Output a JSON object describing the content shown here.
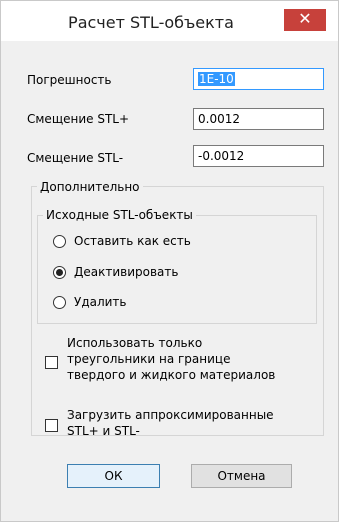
{
  "window": {
    "title": "Расчет STL-объекта",
    "close_symbol": "✕"
  },
  "fields": {
    "tolerance_label": "Погрешность",
    "tolerance_value": "1E-10",
    "offset_plus_label": "Смещение STL+",
    "offset_plus_value": "0.0012",
    "offset_minus_label": "Смещение STL-",
    "offset_minus_value": "-0.0012"
  },
  "additional": {
    "title": "Дополнительно",
    "source_group": {
      "title": "Исходные STL-объекты",
      "options": [
        {
          "label": "Оставить как есть",
          "selected": false
        },
        {
          "label": "Деактивировать",
          "selected": true
        },
        {
          "label": "Удалить",
          "selected": false
        }
      ]
    },
    "checkbox1": {
      "line1": "Использовать только",
      "line2": "треугольники на границе",
      "line3": "твердого и жидкого материалов",
      "checked": false
    },
    "checkbox2": {
      "line1": "Загрузить аппроксимированные",
      "line2": "STL+ и STL-",
      "checked": false
    }
  },
  "buttons": {
    "ok": "ОК",
    "cancel": "Отмена"
  },
  "colors": {
    "close_button": "#c7413b",
    "selection": "#3399ff"
  }
}
